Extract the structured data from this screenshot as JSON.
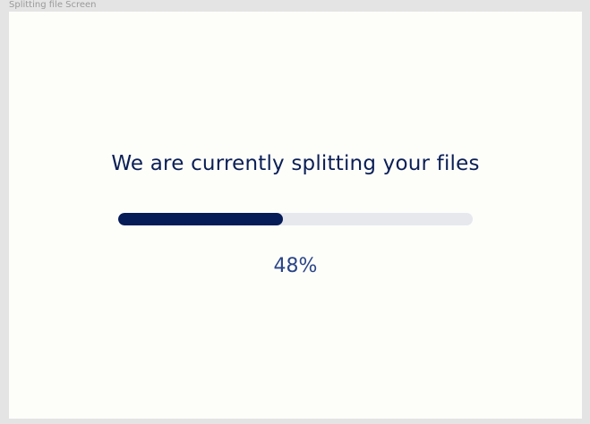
{
  "frame_label": "Splitting file Screen",
  "splitting": {
    "heading": "We are currently splitting your files",
    "progress_fraction": 0.465,
    "percent_label": "48%"
  },
  "colors": {
    "background": "#e4e4e4",
    "card": "#fdfdfa",
    "heading": "#0b1f56",
    "progress_fill": "#061c58",
    "progress_track": "#e6e8ee",
    "percent_text": "#2a4587"
  }
}
